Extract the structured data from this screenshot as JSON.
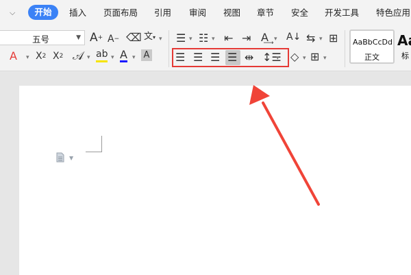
{
  "menubar": {
    "chevron_icon": "chevron-down-icon",
    "active_tab": "开始",
    "tabs": [
      "插入",
      "页面布局",
      "引用",
      "审阅",
      "视图",
      "章节",
      "安全",
      "开发工具",
      "特色应用"
    ]
  },
  "toolbar": {
    "font_size_value": "五号",
    "style_normal_preview": "AaBbCcDd",
    "style_normal_label": "正文",
    "style_heading_preview": "Aa",
    "style_heading_label": "标"
  },
  "colors": {
    "accent": "#3b82f6",
    "highlight_red": "#e53935",
    "font_color_underline": "#1a1aff",
    "highlight_yellow": "#f6e300",
    "clear_format_red": "#e53935"
  }
}
